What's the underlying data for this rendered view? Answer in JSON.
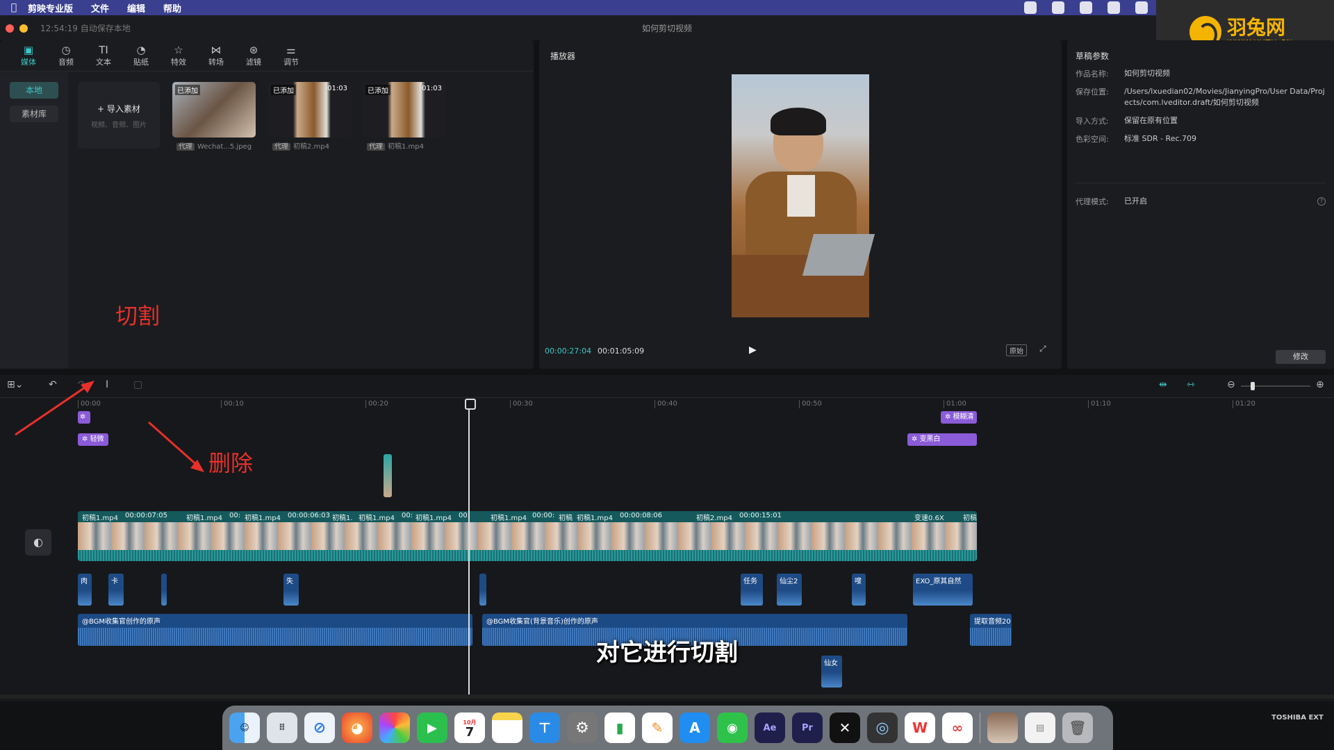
{
  "menubar": {
    "items": [
      "剪映专业版",
      "文件",
      "编辑",
      "帮助"
    ]
  },
  "logo": {
    "brand": "羽兔网",
    "url": "WWW.YUTU.CN"
  },
  "window": {
    "autosave": "12:54:19 自动保存本地",
    "title": "如何剪切视频"
  },
  "toolbar": {
    "tools": [
      "媒体",
      "音频",
      "文本",
      "贴纸",
      "特效",
      "转场",
      "滤镜",
      "调节"
    ]
  },
  "sidebar": {
    "local": "本地",
    "library": "素材库"
  },
  "import": {
    "label": "导入素材",
    "hint": "视频、音频、图片"
  },
  "media": [
    {
      "tag": "已添加",
      "duration": "",
      "proxy": "代理",
      "name": "Wechat...5.jpeg"
    },
    {
      "tag": "已添加",
      "duration": "01:03",
      "proxy": "代理",
      "name": "初稿2.mp4"
    },
    {
      "tag": "已添加",
      "duration": "01:03",
      "proxy": "代理",
      "name": "初稿1.mp4"
    }
  ],
  "player": {
    "header": "播放器",
    "current": "00:00:27:04",
    "total": "00:01:05:09",
    "ratio": "原始"
  },
  "props": {
    "header": "草稿参数",
    "rows": [
      {
        "k": "作品名称:",
        "v": "如何剪切视频"
      },
      {
        "k": "保存位置:",
        "v": "/Users/lxuedian02/Movies/JianyingPro/User Data/Projects/com.lveditor.draft/如何剪切视频"
      },
      {
        "k": "导入方式:",
        "v": "保留在原有位置"
      },
      {
        "k": "色彩空间:",
        "v": "标准 SDR - Rec.709"
      },
      {
        "k": "代理模式:",
        "v": "已开启"
      }
    ],
    "edit": "修改"
  },
  "annotations": {
    "cut": "切割",
    "delete": "删除"
  },
  "ruler": [
    "00:00",
    "00:10",
    "00:20",
    "00:30",
    "00:40",
    "00:50",
    "01:00",
    "01:10",
    "01:20"
  ],
  "effects": {
    "light": "轻微",
    "blur": "模糊清",
    "blackwhite": "变黑白",
    "speed": "变速0.6X"
  },
  "clips": [
    "初稿1.mp4",
    "00:00:07:05",
    "初稿1.mp4",
    "00:",
    "初稿1.mp4",
    "00:00:06:03",
    "初稿1.",
    "初稿1.mp4",
    "00:",
    "初稿1.mp4",
    "00:",
    "初稿1.mp4",
    "00:00:",
    "初稿",
    "初稿1.mp4",
    "00:00:08:06",
    "初稿2.mp4",
    "00:00:15:01",
    "初稿"
  ],
  "sfx": [
    "肉",
    "卡",
    "",
    "失",
    "",
    "任务",
    "仙尘2",
    "嗖",
    "EXO_原其自然",
    "仙女"
  ],
  "bgm": [
    "@BGM收集官创作的原声",
    "@BGM收集官(背景音乐)创作的原声",
    "提取音频20"
  ],
  "subtitle": "对它进行切割",
  "dock": {
    "ext": "TOSHIBA EXT",
    "apps": [
      "Finder",
      "Launchpad",
      "Safari",
      "Firefox",
      "Photos",
      "FaceTime",
      "Calendar",
      "Notes",
      "Keynote",
      "Settings",
      "Numbers",
      "Pages",
      "App Store",
      "WeChat",
      "Ae",
      "Pr",
      "CapCut",
      "QuickTime",
      "WPS",
      "Creative Cloud",
      "Preview",
      "Documents",
      "Trash"
    ],
    "calendar_day": "7",
    "calendar_month": "10月"
  }
}
